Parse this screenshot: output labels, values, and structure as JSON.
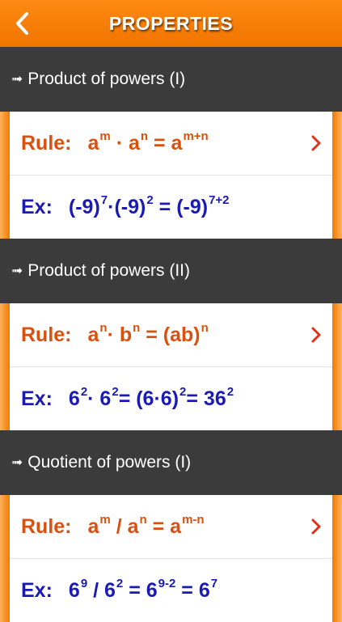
{
  "nav": {
    "title": "PROPERTIES"
  },
  "sections": [
    {
      "header": "Product of powers (I)",
      "rule_label": "Rule:",
      "ex_label": "Ex:"
    },
    {
      "header": "Product of powers (II)",
      "rule_label": "Rule:",
      "ex_label": "Ex:"
    },
    {
      "header": "Quotient of powers (I)",
      "rule_label": "Rule:",
      "ex_label": "Ex:"
    }
  ],
  "formulas": {
    "s0_rule": [
      "a",
      "m",
      " · a",
      "n",
      " = a",
      "m+n"
    ],
    "s0_ex": [
      "(-9)",
      "7",
      "·(-9)",
      "2",
      " = (-9)",
      "7+2"
    ],
    "s1_rule": [
      "a",
      "n",
      "· b",
      "n",
      " = (ab)",
      "n"
    ],
    "s1_ex": [
      "6",
      "2",
      "· 6",
      "2",
      "= (6·6)",
      "2",
      "= 36",
      "2"
    ],
    "s2_rule": [
      "a",
      "m",
      " / a",
      "n",
      " = a",
      "m-n"
    ],
    "s2_ex": [
      "6",
      "9",
      " / 6",
      "2",
      " = 6",
      "9-2",
      " = 6",
      "7"
    ]
  },
  "colors": {
    "nav": "#f07a00",
    "rule": "#d9500f",
    "example": "#1a1ab4",
    "section_bg": "#3b3b3b"
  },
  "icons": {
    "back": "chevron-left-icon",
    "row_disclosure": "chevron-right-icon",
    "bullet": "right-arrow-icon"
  }
}
